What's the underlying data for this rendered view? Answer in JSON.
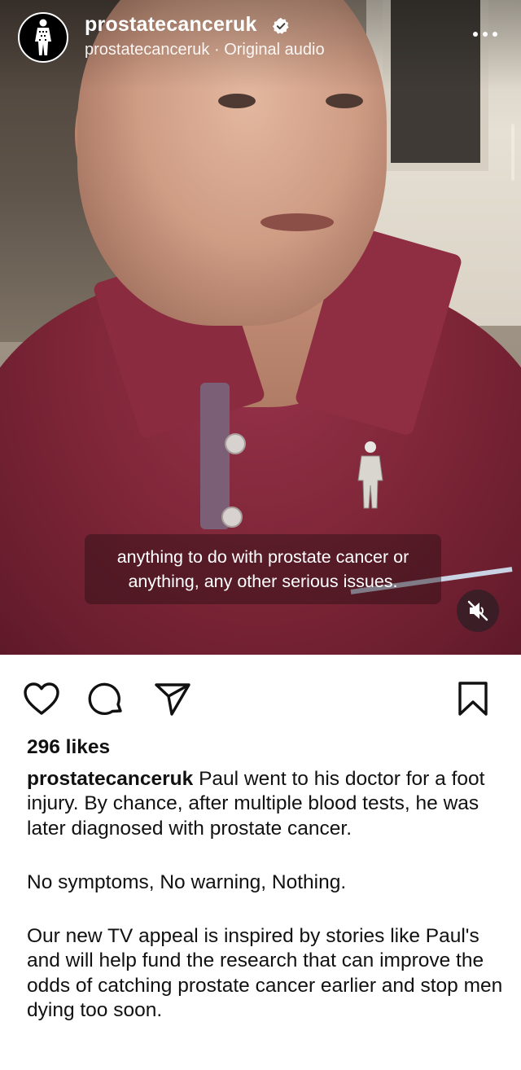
{
  "post": {
    "username": "prostatecanceruk",
    "subline": "prostatecanceruk · Original audio",
    "subtitle": "anything to do with prostate cancer or anything, any other serious issues.",
    "likes": "296 likes",
    "caption_user": "prostatecanceruk",
    "caption_p1": " Paul went to his doctor for a foot injury. By chance, after multiple blood tests, he was later diagnosed with prostate cancer.",
    "caption_p2": "No symptoms, No warning, Nothing.",
    "caption_p3": "Our new TV appeal is inspired by stories like Paul's and will help fund the research that can improve the odds of catching prostate cancer earlier and stop men dying too soon."
  },
  "icons": {
    "verified": "verified-badge-icon",
    "more": "more-options-icon",
    "mute": "muted-speaker-icon",
    "like": "heart-icon",
    "comment": "comment-bubble-icon",
    "share": "paper-plane-icon",
    "save": "bookmark-icon"
  },
  "colors": {
    "text": "#111111",
    "background": "#ffffff",
    "shirt": "#7e2638"
  }
}
